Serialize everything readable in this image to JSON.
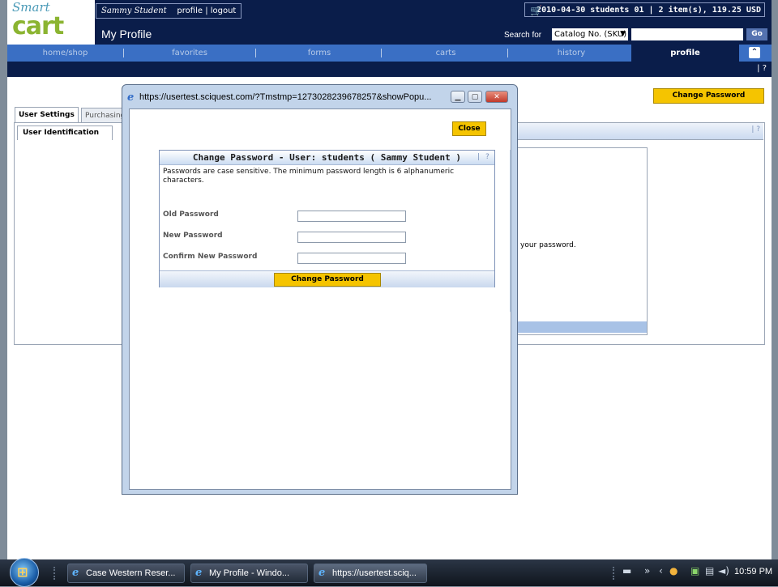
{
  "header": {
    "logo_top": "Smart",
    "logo_bottom": "cart",
    "user_name": "Sammy Student",
    "user_links": "profile | logout",
    "page_title": "My Profile",
    "cart_summary": "2010-04-30 students 01 | 2 item(s), 119.25 USD",
    "search_label": "Search for",
    "search_option": "Catalog No. (SKU)",
    "go_label": "Go"
  },
  "nav": {
    "items": [
      "home/shop",
      "favorites",
      "forms",
      "carts",
      "history"
    ],
    "active": "profile",
    "help": "?"
  },
  "main": {
    "change_password_label": "Change Password",
    "tabs": [
      "User Settings",
      "Purchasing"
    ],
    "subtab": "User Identification",
    "help": "?",
    "partial_text": "your password."
  },
  "popup": {
    "url": "https://usertest.sciquest.com/?Tmstmp=1273028239678257&showPopu...",
    "close_label": "Close",
    "form_title": "Change Password - User: students ( Sammy Student )",
    "form_help": "?",
    "description": "Passwords are case sensitive. The minimum password length is 6 alphanumeric characters.",
    "fields": [
      "Old Password",
      "New Password",
      "Confirm New Password"
    ],
    "submit_label": "Change Password"
  },
  "taskbar": {
    "buttons": [
      "Case Western Reser...",
      "My Profile - Windo...",
      "https://usertest.sciq..."
    ],
    "clock": "10:59 PM"
  },
  "colors": {
    "header_bg": "#0a1d4a",
    "nav_bg": "#3a6fc4",
    "button_yellow": "#f5c400"
  }
}
